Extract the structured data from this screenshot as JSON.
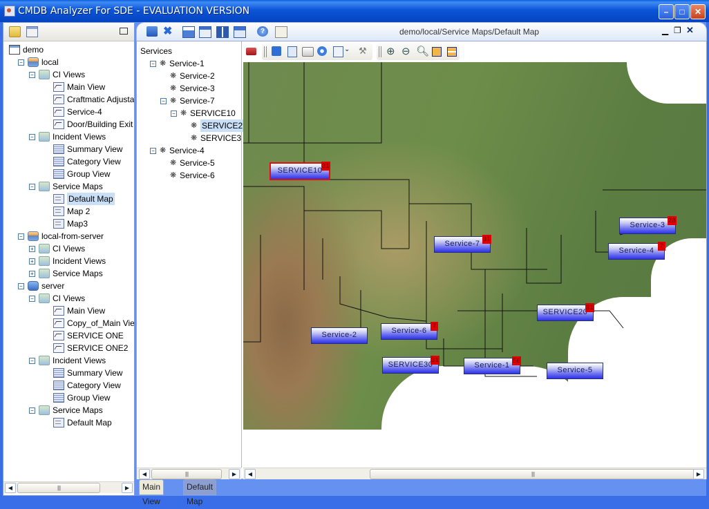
{
  "window": {
    "title": "CMDB Analyzer For SDE - EVALUATION VERSION",
    "controls": [
      "minimize",
      "maximize",
      "close"
    ]
  },
  "left_panel": {
    "toolbar_icons": [
      "new-folder-icon",
      "import-icon",
      "undock-icon"
    ],
    "tree": [
      {
        "label": "demo",
        "level": 0,
        "icon": "root-icon",
        "expander": ""
      },
      {
        "label": "local",
        "level": 1,
        "icon": "database-icon",
        "expander": "minus"
      },
      {
        "label": "CI Views",
        "level": 2,
        "icon": "folder-icon",
        "expander": "minus"
      },
      {
        "label": "Main View",
        "level": 3,
        "icon": "view-icon",
        "expander": ""
      },
      {
        "label": "Craftmatic Adjusta",
        "level": 3,
        "icon": "view-icon",
        "expander": ""
      },
      {
        "label": "Service-4",
        "level": 3,
        "icon": "view-icon",
        "expander": ""
      },
      {
        "label": "Door/Building Exit",
        "level": 3,
        "icon": "view-icon",
        "expander": ""
      },
      {
        "label": "Incident Views",
        "level": 2,
        "icon": "folder-icon",
        "expander": "minus"
      },
      {
        "label": "Summary View",
        "level": 3,
        "icon": "table-icon",
        "expander": ""
      },
      {
        "label": "Category View",
        "level": 3,
        "icon": "table-icon",
        "expander": ""
      },
      {
        "label": "Group View",
        "level": 3,
        "icon": "table-icon",
        "expander": ""
      },
      {
        "label": "Service Maps",
        "level": 2,
        "icon": "folder-icon",
        "expander": "minus"
      },
      {
        "label": "Default Map",
        "level": 3,
        "icon": "map-icon",
        "expander": "",
        "selected": true
      },
      {
        "label": "Map 2",
        "level": 3,
        "icon": "map-icon",
        "expander": ""
      },
      {
        "label": "Map3",
        "level": 3,
        "icon": "map-icon",
        "expander": ""
      },
      {
        "label": "local-from-server",
        "level": 1,
        "icon": "database-icon",
        "expander": "minus"
      },
      {
        "label": "CI Views",
        "level": 2,
        "icon": "folder-icon",
        "expander": "plus"
      },
      {
        "label": "Incident Views",
        "level": 2,
        "icon": "folder-icon",
        "expander": "plus"
      },
      {
        "label": "Service Maps",
        "level": 2,
        "icon": "folder-icon",
        "expander": "plus"
      },
      {
        "label": "server",
        "level": 1,
        "icon": "server-icon",
        "expander": "minus"
      },
      {
        "label": "CI Views",
        "level": 2,
        "icon": "folder-icon",
        "expander": "minus"
      },
      {
        "label": "Main View",
        "level": 3,
        "icon": "view-icon",
        "expander": ""
      },
      {
        "label": "Copy_of_Main View",
        "level": 3,
        "icon": "view-icon",
        "expander": ""
      },
      {
        "label": "SERVICE ONE",
        "level": 3,
        "icon": "view-icon",
        "expander": ""
      },
      {
        "label": "SERVICE ONE2",
        "level": 3,
        "icon": "view-icon",
        "expander": ""
      },
      {
        "label": "Incident Views",
        "level": 2,
        "icon": "folder-icon",
        "expander": "minus"
      },
      {
        "label": "Summary View",
        "level": 3,
        "icon": "table-icon",
        "expander": ""
      },
      {
        "label": "Category View",
        "level": 3,
        "icon": "table-icon",
        "expander": ""
      },
      {
        "label": "Group View",
        "level": 3,
        "icon": "table-icon",
        "expander": ""
      },
      {
        "label": "Service Maps",
        "level": 2,
        "icon": "folder-icon",
        "expander": "minus"
      },
      {
        "label": "Default Map",
        "level": 3,
        "icon": "map-icon",
        "expander": ""
      }
    ]
  },
  "main_toolbar": {
    "icons": [
      "tile-icon",
      "close-all-icon",
      "add-top-icon",
      "add-window-icon",
      "grid-icon",
      "cascade-icon",
      "help-icon",
      "panel-icon"
    ],
    "path": "demo/local/Service Maps/Default Map",
    "frame_controls": [
      "minimize",
      "restore",
      "close"
    ]
  },
  "services_tree": {
    "header": "Services",
    "items": [
      {
        "label": "Service-1",
        "level": 0,
        "expander": "minus"
      },
      {
        "label": "Service-2",
        "level": 1,
        "expander": ""
      },
      {
        "label": "Service-3",
        "level": 1,
        "expander": ""
      },
      {
        "label": "Service-7",
        "level": 1,
        "expander": "minus"
      },
      {
        "label": "SERVICE10",
        "level": 2,
        "expander": "minus"
      },
      {
        "label": "SERVICE2",
        "level": 3,
        "expander": "",
        "selected": true
      },
      {
        "label": "SERVICE3",
        "level": 3,
        "expander": ""
      },
      {
        "label": "Service-4",
        "level": 0,
        "expander": "minus"
      },
      {
        "label": "Service-5",
        "level": 1,
        "expander": ""
      },
      {
        "label": "Service-6",
        "level": 1,
        "expander": ""
      }
    ]
  },
  "map_toolbar": {
    "icons": [
      "toolbox-icon",
      "save-icon",
      "copy-icon",
      "print-icon",
      "snapshot-icon",
      "export-icon",
      "dropdown-icon",
      "settings-icon",
      "zoom-in-icon",
      "zoom-out-icon",
      "zoom-reset-icon",
      "fit-icon",
      "fit-height-icon"
    ]
  },
  "map": {
    "nodes": [
      {
        "label": "SERVICE10",
        "badge": "31",
        "selected": true
      },
      {
        "label": "Service-7",
        "badge": "31"
      },
      {
        "label": "Service-3",
        "badge": "28"
      },
      {
        "label": "Service-4",
        "badge": "7"
      },
      {
        "label": "SERVICE20",
        "badge": "31"
      },
      {
        "label": "Service-2",
        "badge": ""
      },
      {
        "label": "Service-6",
        "badge": "7"
      },
      {
        "label": "SERVICE30",
        "badge": "31"
      },
      {
        "label": "Service-1",
        "badge": "56"
      },
      {
        "label": "Service-5",
        "badge": ""
      }
    ],
    "badge_color": "#e00000",
    "node_color": "#3a40e8"
  },
  "bottom_tabs": [
    {
      "label": "Main View",
      "active": false
    },
    {
      "label": "Default Map",
      "active": true
    }
  ]
}
